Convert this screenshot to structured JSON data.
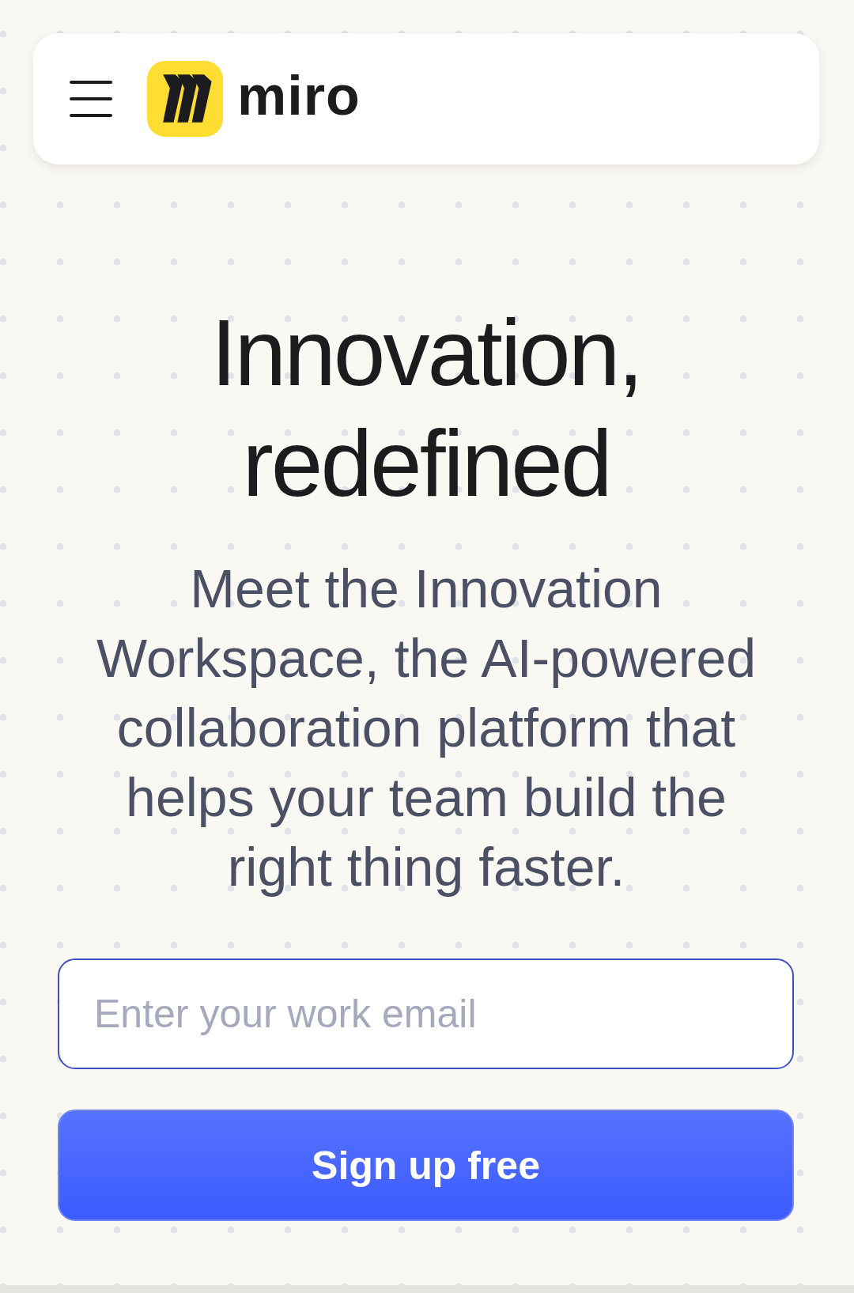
{
  "header": {
    "logo": {
      "wordmark": "miro"
    }
  },
  "hero": {
    "title": "Innovation, redefined",
    "subtitle": "Meet the Innovation Workspace, the AI-powered collaboration platform that helps your team build the right thing faster."
  },
  "signup_form": {
    "email": {
      "placeholder": "Enter your work email"
    },
    "submit": {
      "label": "Sign up free"
    }
  }
}
